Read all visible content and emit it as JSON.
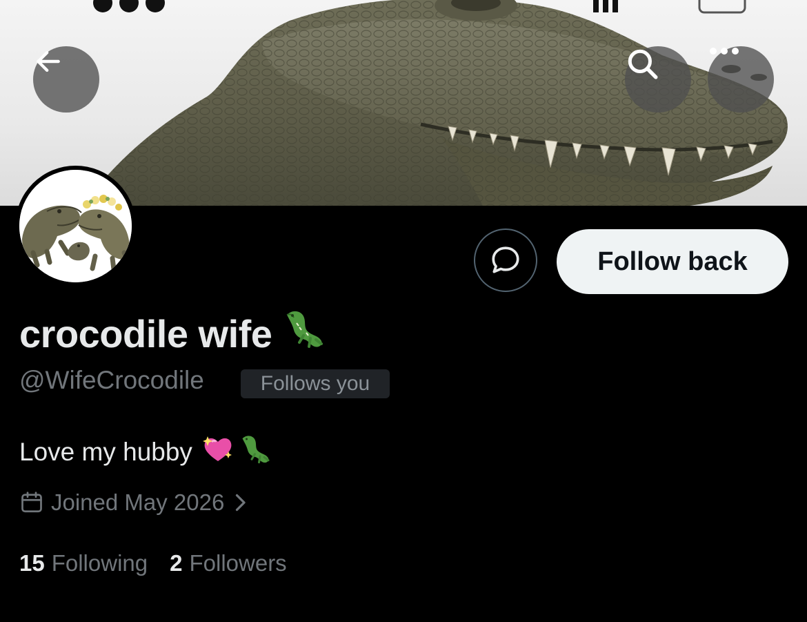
{
  "profile": {
    "display_name": "crocodile wife",
    "handle": "@WifeCrocodile",
    "follows_you_badge": "Follows you",
    "bio": "Love my hubby",
    "joined": "Joined May 2026",
    "following_count": "15",
    "following_label": "Following",
    "followers_count": "2",
    "followers_label": "Followers"
  },
  "actions": {
    "follow_back_label": "Follow back"
  },
  "icons": {
    "back": "arrow-left-icon",
    "search": "search-icon",
    "more": "more-horizontal-icon",
    "message": "message-bubble-icon",
    "calendar": "calendar-icon",
    "chevron": "chevron-right-icon",
    "bio_emojis": [
      "sparkling-heart-emoji",
      "crocodile-emoji"
    ],
    "name_emoji": "crocodile-emoji"
  },
  "colors": {
    "background": "#000000",
    "primary_text": "#e7e9ea",
    "secondary_text": "#71767b",
    "follow_button_bg": "#eff3f4",
    "badge_bg": "#202327"
  }
}
